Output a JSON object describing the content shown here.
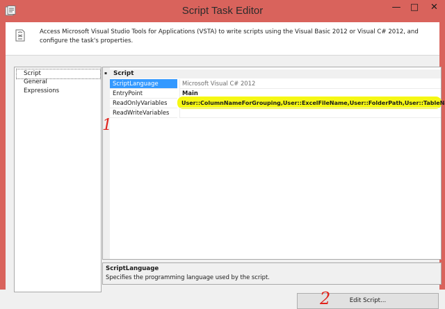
{
  "window": {
    "title": "Script Task Editor",
    "minimize_glyph": "—",
    "maximize_glyph": "□",
    "close_glyph": "✕",
    "frame_color": "#d9635c"
  },
  "header": {
    "description": "Access Microsoft Visual Studio Tools for Applications (VSTA) to write scripts using the Visual Basic 2012 or Visual C# 2012, and configure the task's properties.",
    "icon": "script-document-icon"
  },
  "nav": {
    "items": [
      {
        "label": "Script",
        "selected": true
      },
      {
        "label": "General",
        "selected": false
      },
      {
        "label": "Expressions",
        "selected": false
      }
    ]
  },
  "property_grid": {
    "category": "Script",
    "collapse_glyph": "▪",
    "rows": [
      {
        "name": "ScriptLanguage",
        "value": "Microsoft Visual C# 2012",
        "selected": true
      },
      {
        "name": "EntryPoint",
        "value": "Main"
      },
      {
        "name": "ReadOnlyVariables",
        "value": "User::ColumnNameForGrouping,User::ExcelFileName,User::FolderPath,User::TableName"
      },
      {
        "name": "ReadWriteVariables",
        "value": ""
      }
    ],
    "highlight_color": "#f5f700"
  },
  "description_box": {
    "heading": "ScriptLanguage",
    "text": "Specifies the programming language used by the script."
  },
  "buttons": {
    "edit_script": "Edit Script..."
  },
  "annotations": {
    "marker_1": "1",
    "marker_2": "2",
    "color": "#e0231c"
  }
}
